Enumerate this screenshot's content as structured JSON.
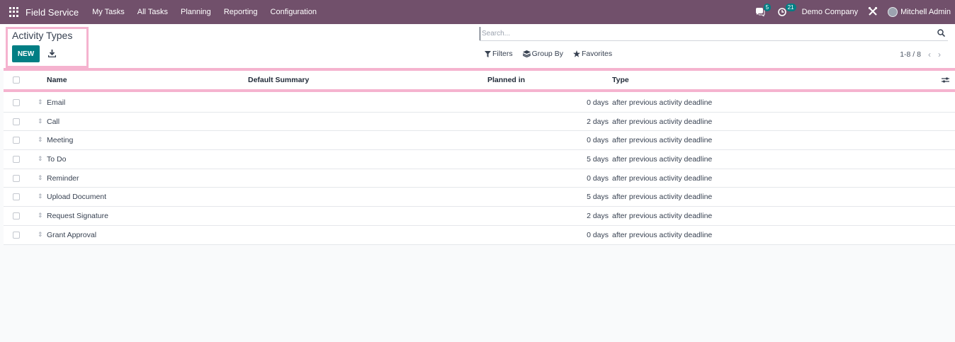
{
  "navbar": {
    "app_name": "Field Service",
    "menu": [
      "My Tasks",
      "All Tasks",
      "Planning",
      "Reporting",
      "Configuration"
    ],
    "messages_count": "5",
    "activities_count": "21",
    "company": "Demo Company",
    "user": "Mitchell Admin"
  },
  "control_panel": {
    "title": "Activity Types",
    "new_label": "NEW",
    "search_placeholder": "Search...",
    "filters_label": "Filters",
    "group_by_label": "Group By",
    "favorites_label": "Favorites",
    "pager": "1-8 / 8"
  },
  "table": {
    "columns": {
      "name": "Name",
      "default_summary": "Default Summary",
      "planned_in": "Planned in",
      "type": "Type"
    },
    "rows": [
      {
        "name": "Email",
        "planned_in": "0 days",
        "type": "after previous activity deadline"
      },
      {
        "name": "Call",
        "planned_in": "2 days",
        "type": "after previous activity deadline"
      },
      {
        "name": "Meeting",
        "planned_in": "0 days",
        "type": "after previous activity deadline"
      },
      {
        "name": "To Do",
        "planned_in": "5 days",
        "type": "after previous activity deadline"
      },
      {
        "name": "Reminder",
        "planned_in": "0 days",
        "type": "after previous activity deadline"
      },
      {
        "name": "Upload Document",
        "planned_in": "5 days",
        "type": "after previous activity deadline"
      },
      {
        "name": "Request Signature",
        "planned_in": "2 days",
        "type": "after previous activity deadline"
      },
      {
        "name": "Grant Approval",
        "planned_in": "0 days",
        "type": "after previous activity deadline"
      }
    ]
  },
  "colors": {
    "navbar": "#71506b",
    "primary": "#017e84",
    "highlight": "#f5b3cf"
  }
}
